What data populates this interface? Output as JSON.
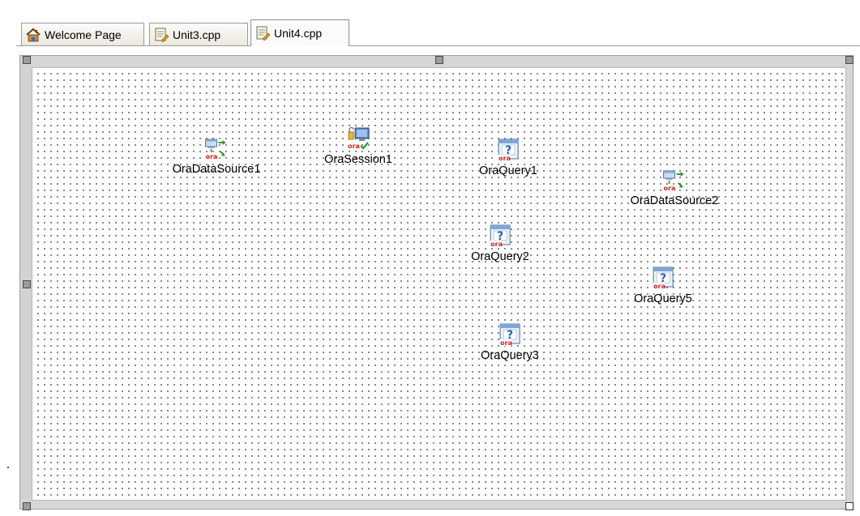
{
  "tabs": [
    {
      "label": "Welcome Page",
      "icon": "house-icon",
      "active": false
    },
    {
      "label": "Unit3.cpp",
      "icon": "source-file-icon",
      "active": false
    },
    {
      "label": "Unit4.cpp",
      "icon": "source-file-icon",
      "active": true
    }
  ],
  "components": [
    {
      "id": "oradatasource1",
      "label": "OraDataSource1",
      "icon": "ora-datasource-icon"
    },
    {
      "id": "orasession1",
      "label": "OraSession1",
      "icon": "ora-session-icon"
    },
    {
      "id": "oraquery1",
      "label": "OraQuery1",
      "icon": "ora-query-icon"
    },
    {
      "id": "oradatasource2",
      "label": "OraDataSource2",
      "icon": "ora-datasource-icon"
    },
    {
      "id": "oraquery2",
      "label": "OraQuery2",
      "icon": "ora-query-icon"
    },
    {
      "id": "oraquery5",
      "label": "OraQuery5",
      "icon": "ora-query-icon"
    },
    {
      "id": "oraquery3",
      "label": "OraQuery3",
      "icon": "ora-query-icon"
    }
  ],
  "icon_text": "ora",
  "colors": {
    "ora_red": "#cc2222",
    "arrow_green": "#2a9a2a",
    "query_blue": "#2a64b8",
    "grid_dot": "#6a6a6a"
  }
}
